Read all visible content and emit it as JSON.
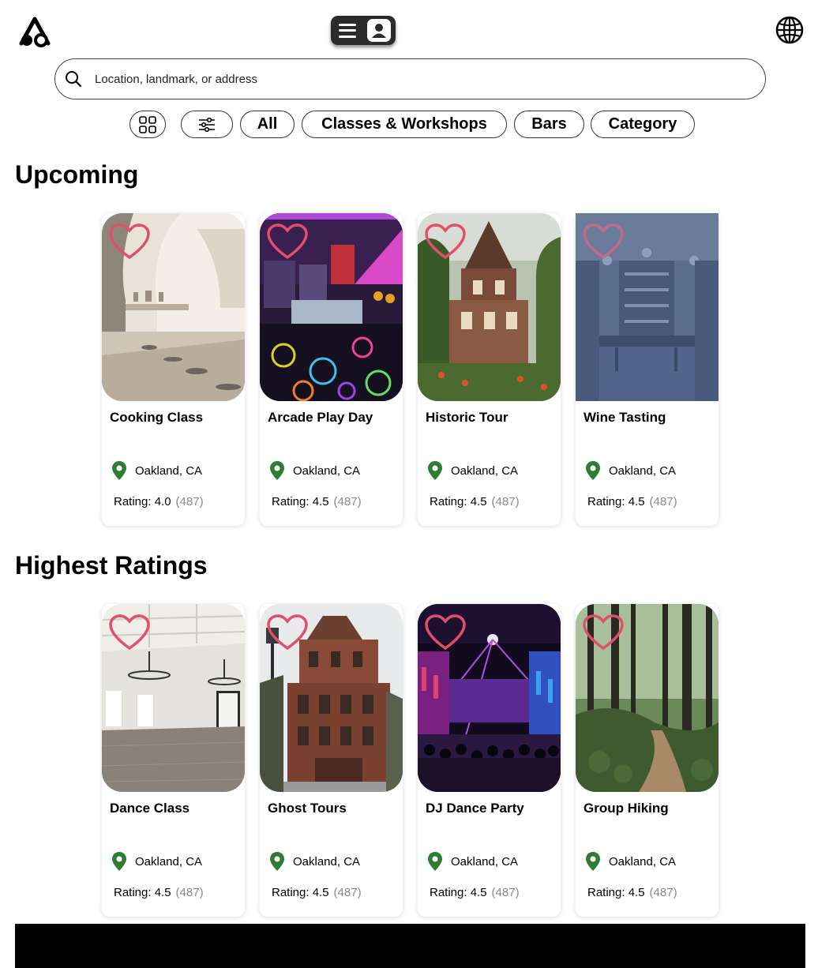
{
  "search": {
    "placeholder": "Location, landmark, or address"
  },
  "filters": {
    "grid_icon": "grid-icon",
    "sliders_icon": "sliders-icon",
    "chips": [
      "All",
      "Classes & Workshops",
      "Bars",
      "Category"
    ]
  },
  "sections": [
    {
      "title": "Upcoming",
      "cards": [
        {
          "name": "Cooking Class",
          "location": "Oakland, CA",
          "rating": "Rating: 4.0",
          "count": "(487)"
        },
        {
          "name": "Arcade Play Day",
          "location": "Oakland, CA",
          "rating": "Rating: 4.5",
          "count": "(487)"
        },
        {
          "name": "Historic Tour",
          "location": "Oakland, CA",
          "rating": "Rating: 4.5",
          "count": "(487)"
        },
        {
          "name": "Wine Tasting",
          "location": "Oakland, CA",
          "rating": "Rating: 4.5",
          "count": "(487)"
        }
      ]
    },
    {
      "title": "Highest Ratings",
      "cards": [
        {
          "name": "Dance Class",
          "location": "Oakland, CA",
          "rating": "Rating: 4.5",
          "count": "(487)"
        },
        {
          "name": "Ghost Tours",
          "location": "Oakland, CA",
          "rating": "Rating: 4.5",
          "count": "(487)"
        },
        {
          "name": "DJ Dance Party",
          "location": "Oakland, CA",
          "rating": "Rating: 4.5",
          "count": "(487)"
        },
        {
          "name": "Group Hiking",
          "location": "Oakland, CA",
          "rating": "Rating: 4.5",
          "count": "(487)"
        }
      ]
    }
  ],
  "colors": {
    "heart": "#e0506a",
    "pin": "#2e7d32",
    "count": "#8a8a8a"
  }
}
